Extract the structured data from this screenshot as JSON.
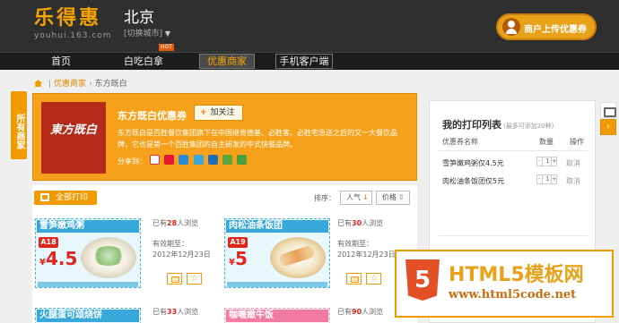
{
  "header": {
    "logo_cn": "乐得惠",
    "logo_en": "youhui.163.com",
    "city": "北京",
    "city_switch": "[切换城市]",
    "merchant_button": "商户上传优惠券"
  },
  "nav": {
    "items": [
      {
        "label": "首页"
      },
      {
        "label": "白吃白拿"
      },
      {
        "label": "优惠商家"
      },
      {
        "label": "手机客户端"
      }
    ],
    "hot_badge": "HOT"
  },
  "breadcrumb": {
    "level1": "优惠商家",
    "level2": "东方既白"
  },
  "side_tab": {
    "label": "所有商家"
  },
  "store": {
    "logo_text": "東方既白",
    "name": "东方既白优惠券",
    "follow_label": "加关注",
    "description": "东方既白是百胜餐饮集团旗下在中国继肯德基、必胜客、必胜宅急送之后的又一大餐饮品牌，它也是第一个百胜集团的自主研发的中式快餐品牌。",
    "share_label": "分享到："
  },
  "toolbar": {
    "print_all": "全部打印",
    "sort_label": "排序：",
    "sort_popularity": "人气",
    "sort_price": "价格"
  },
  "coupons": [
    {
      "title": "雪笋嫩鸡粥",
      "code": "A18",
      "price_currency": "¥",
      "price": "4.5",
      "views_prefix": "已有",
      "views": "28",
      "views_suffix": "人浏览",
      "valid_label": "有效期至：",
      "valid_date": "2012年12月23日"
    },
    {
      "title": "肉松油条饭团",
      "code": "A19",
      "price_currency": "¥",
      "price": "5",
      "views_prefix": "已有",
      "views": "30",
      "views_suffix": "人浏览",
      "valid_label": "有效期至：",
      "valid_date": "2012年12月23日"
    },
    {
      "title": "火腿蛋可颂烧饼",
      "views_prefix": "已有",
      "views": "33",
      "views_suffix": "人浏览"
    },
    {
      "title": "咖喱嫩牛饭",
      "views_prefix": "已有",
      "views": "90",
      "views_suffix": "人浏览"
    }
  ],
  "print_list": {
    "title": "我的打印列表",
    "hint": "(最多可添加20种)",
    "col_name": "优惠券名称",
    "col_qty": "数量",
    "col_action": "操作",
    "rows": [
      {
        "name": "雪笋嫩鸡粥仅4.5元",
        "qty_minus": "-",
        "qty": "1",
        "qty_plus": "+",
        "action": "取消"
      },
      {
        "name": "肉松油条饭团仅5元",
        "qty_minus": "-",
        "qty": "1",
        "qty_plus": "+",
        "action": "取消"
      }
    ]
  },
  "watermark": {
    "badge": "5",
    "title": "HTML5模板网",
    "url": "www.html5code.net"
  },
  "colors": {
    "brand_orange": "#f29b00",
    "header_bg": "#2f2f2f",
    "coupon_blue": "#36a9da",
    "coupon_pink": "#f37aa0",
    "price_red": "#e0261c"
  }
}
